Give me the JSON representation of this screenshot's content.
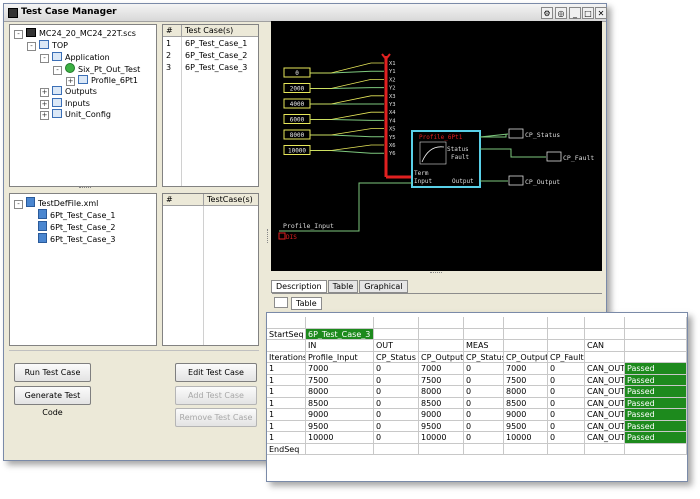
{
  "window": {
    "title": "Test Case Manager",
    "buttons": [
      "⚙",
      "◎",
      "_",
      "□",
      "✕"
    ]
  },
  "tree1": {
    "root": "MC24_20_MC24_22T.scs",
    "items": [
      {
        "label": "TOP",
        "depth": 1,
        "exp": "-"
      },
      {
        "label": "Application",
        "depth": 2,
        "exp": "-"
      },
      {
        "label": "Six_Pt_Out_Test",
        "depth": 3,
        "exp": "-",
        "icon": "check"
      },
      {
        "label": "Profile_6Pt1",
        "depth": 4,
        "exp": "+"
      },
      {
        "label": "Outputs",
        "depth": 2,
        "exp": "+"
      },
      {
        "label": "Inputs",
        "depth": 2,
        "exp": "+"
      },
      {
        "label": "Unit_Config",
        "depth": 2,
        "exp": "+"
      }
    ]
  },
  "cases_top": {
    "col_num": "#",
    "col_name": "Test Case(s)",
    "rows": [
      {
        "n": "1",
        "name": "6P_Test_Case_1"
      },
      {
        "n": "2",
        "name": "6P_Test_Case_2"
      },
      {
        "n": "3",
        "name": "6P_Test_Case_3"
      }
    ]
  },
  "tree2": {
    "root": "TestDefFile.xml",
    "items": [
      "6Pt_Test_Case_1",
      "6Pt_Test_Case_2",
      "6Pt_Test_Case_3"
    ]
  },
  "cases_bottom": {
    "col_num": "#",
    "col_name": "TestCase(s)"
  },
  "buttons": {
    "run": "Run Test Case",
    "generate": "Generate Test Code",
    "edit": "Edit Test Case",
    "add": "Add Test Case",
    "remove": "Remove Test Case"
  },
  "diagram": {
    "inputs": [
      "0",
      "2000",
      "4000",
      "6000",
      "8000",
      "10000"
    ],
    "ports": [
      "X1",
      "Y1",
      "X2",
      "Y2",
      "X3",
      "Y3",
      "X4",
      "Y4",
      "X5",
      "Y5",
      "X6",
      "Y6"
    ],
    "block_title": "Profile_6Pt1",
    "block_in1": "Term",
    "block_in2": "Input",
    "block_out1": "Status",
    "block_out2": "Fault",
    "block_out3": "Output",
    "out_status": "CP_Status",
    "out_fault": "CP_Fault",
    "out_output": "CP_Output",
    "profile_input": "Profile_Input",
    "aux": "DIS"
  },
  "tabs": [
    "Description",
    "Table",
    "Graphical"
  ],
  "subtab": "Table",
  "table": {
    "startseq": "StartSeq",
    "case_name": "6P_Test_Case_3",
    "group_in": "IN",
    "group_out": "OUT",
    "group_meas": "MEAS",
    "group_can": "CAN",
    "headers": [
      "Iterations",
      "Profile_Input",
      "CP_Status",
      "CP_Output",
      "CP_Status",
      "CP_Output",
      "CP_Fault",
      "",
      ""
    ],
    "rows": [
      [
        "1",
        "7000",
        "0",
        "7000",
        "0",
        "7000",
        "0",
        "CAN_OUT",
        "Passed"
      ],
      [
        "1",
        "7500",
        "0",
        "7500",
        "0",
        "7500",
        "0",
        "CAN_OUT",
        "Passed"
      ],
      [
        "1",
        "8000",
        "0",
        "8000",
        "0",
        "8000",
        "0",
        "CAN_OUT",
        "Passed"
      ],
      [
        "1",
        "8500",
        "0",
        "8500",
        "0",
        "8500",
        "0",
        "CAN_OUT",
        "Passed"
      ],
      [
        "1",
        "9000",
        "0",
        "9000",
        "0",
        "9000",
        "0",
        "CAN_OUT",
        "Passed"
      ],
      [
        "1",
        "9500",
        "0",
        "9500",
        "0",
        "9500",
        "0",
        "CAN_OUT",
        "Passed"
      ],
      [
        "1",
        "10000",
        "0",
        "10000",
        "0",
        "10000",
        "0",
        "CAN_OUT",
        "Passed"
      ]
    ],
    "endseq": "EndSeq"
  },
  "colors": {
    "pass": "#1d8a1d",
    "wire_yellow": "#e8e85a",
    "wire_green": "#7ec87e",
    "wire_red": "#e02020",
    "block_cyan": "#59d0e8"
  }
}
